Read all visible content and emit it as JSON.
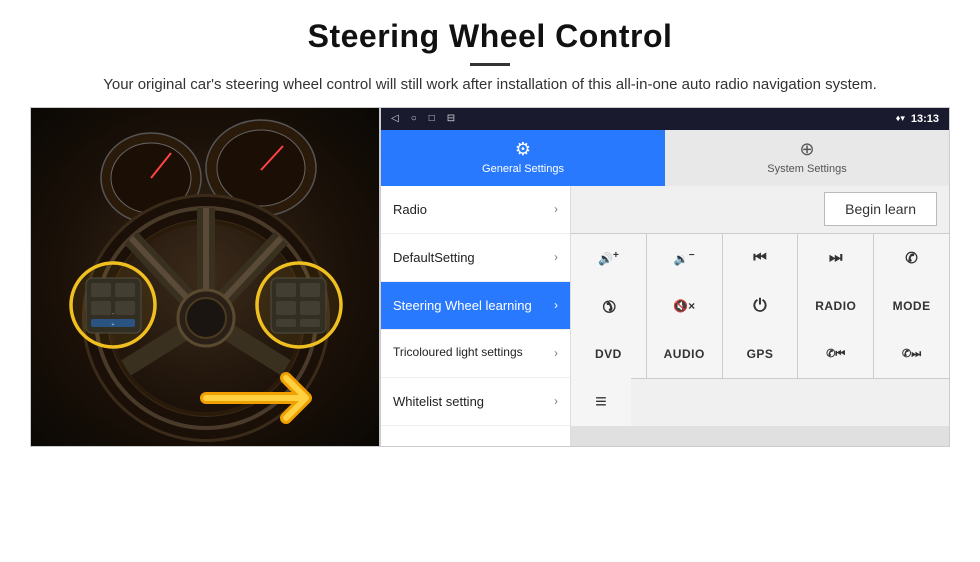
{
  "header": {
    "title": "Steering Wheel Control",
    "divider": true,
    "subtitle": "Your original car's steering wheel control will still work after installation of this all-in-one auto radio navigation system."
  },
  "status_bar": {
    "nav_back": "◁",
    "nav_home": "○",
    "nav_recent": "□",
    "nav_cast": "⊟",
    "signal_icon": "♦",
    "wifi_icon": "▾",
    "time": "13:13"
  },
  "tabs": [
    {
      "id": "general",
      "label": "General Settings",
      "active": true
    },
    {
      "id": "system",
      "label": "System Settings",
      "active": false
    }
  ],
  "menu_items": [
    {
      "id": "radio",
      "label": "Radio",
      "active": false
    },
    {
      "id": "default",
      "label": "DefaultSetting",
      "active": false
    },
    {
      "id": "steering",
      "label": "Steering Wheel learning",
      "active": true
    },
    {
      "id": "tricoloured",
      "label": "Tricoloured light settings",
      "active": false
    },
    {
      "id": "whitelist",
      "label": "Whitelist setting",
      "active": false
    }
  ],
  "controls": {
    "begin_learn_label": "Begin learn",
    "row1": [
      {
        "id": "vol-up",
        "icon": "vol_up",
        "label": "🔊+"
      },
      {
        "id": "vol-down",
        "icon": "vol_down",
        "label": "🔉−"
      },
      {
        "id": "prev",
        "icon": "prev_track",
        "label": "⏮"
      },
      {
        "id": "next",
        "icon": "next_track",
        "label": "⏭"
      },
      {
        "id": "phone",
        "icon": "phone",
        "label": "✆"
      }
    ],
    "row2": [
      {
        "id": "hangup",
        "icon": "hang_up",
        "label": "↩"
      },
      {
        "id": "mute",
        "icon": "mute",
        "label": "🔇×"
      },
      {
        "id": "power",
        "icon": "power",
        "label": "⏻"
      },
      {
        "id": "radio_btn",
        "icon": "text",
        "label": "RADIO"
      },
      {
        "id": "mode_btn",
        "icon": "text",
        "label": "MODE"
      }
    ],
    "row3": [
      {
        "id": "dvd_btn",
        "icon": "text",
        "label": "DVD"
      },
      {
        "id": "audio_btn",
        "icon": "text",
        "label": "AUDIO"
      },
      {
        "id": "gps_btn",
        "icon": "text",
        "label": "GPS"
      },
      {
        "id": "phone2",
        "icon": "phone_prev",
        "label": "📞⏮"
      },
      {
        "id": "phone3",
        "icon": "phone_next",
        "label": "📞⏭"
      }
    ],
    "row4": [
      {
        "id": "list_btn",
        "icon": "list",
        "label": "≡"
      }
    ]
  },
  "car_image": {
    "alt": "Steering wheel of a car with yellow circles highlighting button groups"
  }
}
